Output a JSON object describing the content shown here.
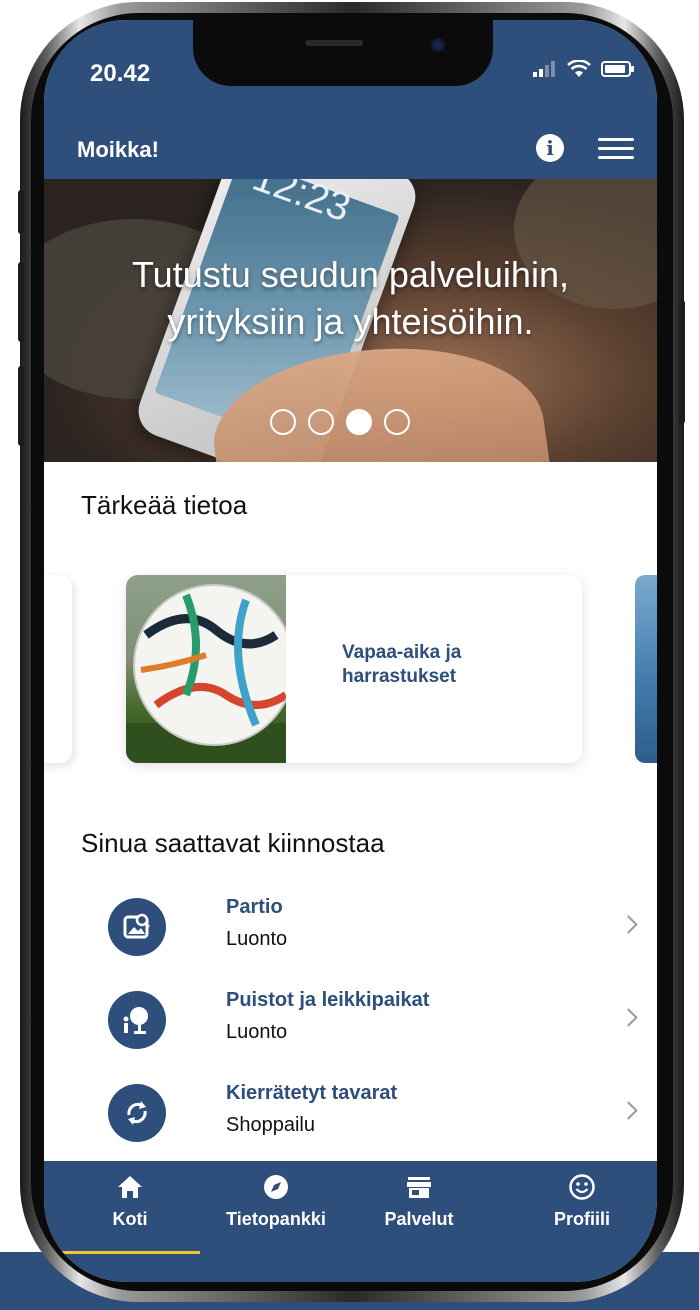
{
  "status_bar": {
    "time": "20.42"
  },
  "app_bar": {
    "title": "Moikka!"
  },
  "banner": {
    "text": "Tutustu seudun palveluihin,\nyrityksiin ja yhteisöihin.",
    "phone_time": "12:23",
    "slide_count": 4,
    "active_slide": 3
  },
  "important": {
    "title": "Tärkeää tietoa",
    "card_label": "Vapaa-aika ja\nharrastukset"
  },
  "suggestions": {
    "title": "Sinua saattavat kiinnostaa",
    "items": [
      {
        "title": "Partio",
        "category": "Luonto",
        "icon": "image-search-icon"
      },
      {
        "title": "Puistot ja leikkipaikat",
        "category": "Luonto",
        "icon": "playground-icon"
      },
      {
        "title": "Kierrätetyt tavarat",
        "category": "Shoppailu",
        "icon": "recycle-icon"
      }
    ]
  },
  "tabs": [
    {
      "label": "Koti",
      "icon": "home-icon",
      "active": true
    },
    {
      "label": "Tietopankki",
      "icon": "compass-icon",
      "active": false
    },
    {
      "label": "Palvelut",
      "icon": "store-icon",
      "active": false
    },
    {
      "label": "Profiili",
      "icon": "smiley-icon",
      "active": false
    }
  ],
  "colors": {
    "primary": "#2e4e7b",
    "accent": "#f4c430"
  }
}
